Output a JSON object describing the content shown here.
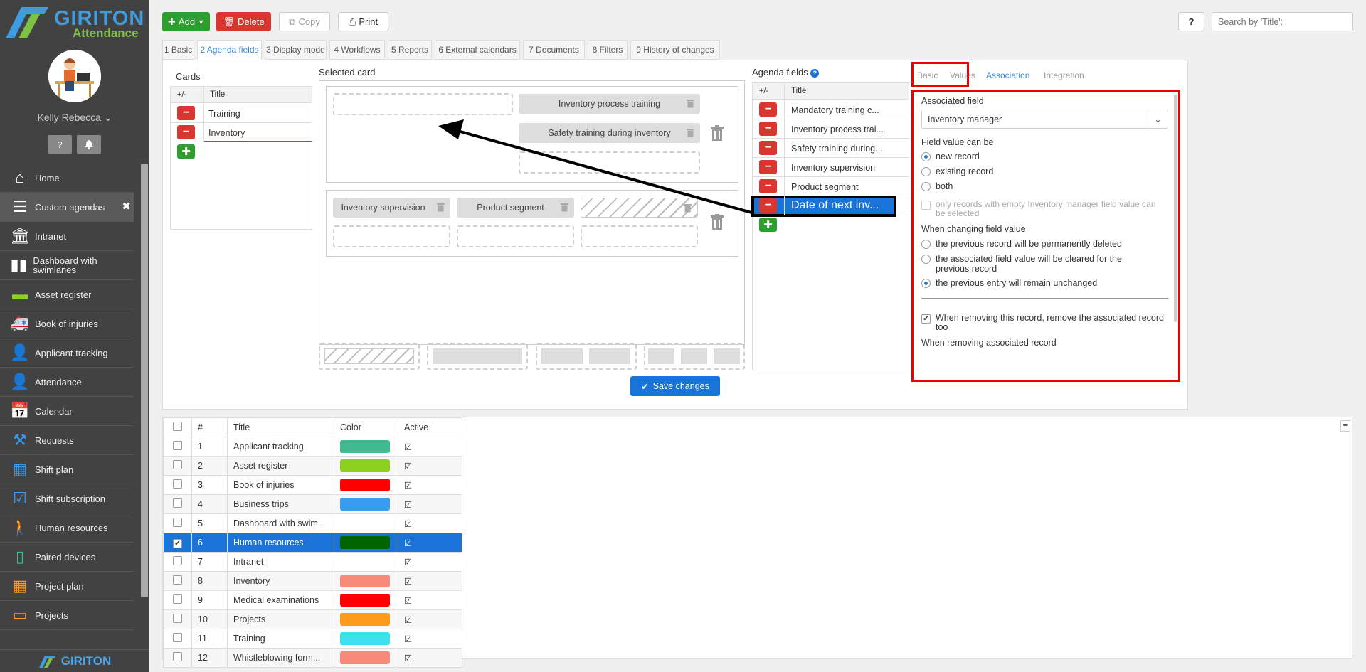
{
  "app": {
    "logo_main": "GIRITON",
    "logo_sub": "Attendance",
    "user": "Kelly Rebecca",
    "footer_logo": "GIRITON"
  },
  "sidebar": {
    "items": [
      {
        "label": "Home",
        "icon": "home-icon",
        "color": "#ffffff"
      },
      {
        "label": "Custom agendas",
        "icon": "list-numbered-icon",
        "color": "#ffffff",
        "active": true
      },
      {
        "label": "Intranet",
        "icon": "building-icon",
        "color": "#ffffff"
      },
      {
        "label": "Dashboard with swimlanes",
        "icon": "columns-icon",
        "color": "#ffffff"
      },
      {
        "label": "Asset register",
        "icon": "archive-box-icon",
        "color": "#8bd11e"
      },
      {
        "label": "Book of injuries",
        "icon": "ambulance-icon",
        "color": "#ff3b2f"
      },
      {
        "label": "Applicant tracking",
        "icon": "user-add-icon",
        "color": "#3dbb8e"
      },
      {
        "label": "Attendance",
        "icon": "user-icon",
        "color": "#3a9cf0"
      },
      {
        "label": "Calendar",
        "icon": "calendar-icon",
        "color": "#3a9cf0"
      },
      {
        "label": "Requests",
        "icon": "gavel-icon",
        "color": "#3a9cf0"
      },
      {
        "label": "Shift plan",
        "icon": "calendar-grid-icon",
        "color": "#3a9cf0"
      },
      {
        "label": "Shift subscription",
        "icon": "calendar-check-icon",
        "color": "#3a9cf0"
      },
      {
        "label": "Human resources",
        "icon": "person-icon",
        "color": "#22c98a"
      },
      {
        "label": "Paired devices",
        "icon": "mobile-icon",
        "color": "#22c98a"
      },
      {
        "label": "Project plan",
        "icon": "calendar-grid-icon",
        "color": "#ff9a1a"
      },
      {
        "label": "Projects",
        "icon": "folder-icon",
        "color": "#ff9a1a"
      }
    ]
  },
  "toolbar": {
    "add": "Add",
    "delete": "Delete",
    "copy": "Copy",
    "print": "Print",
    "help": "?",
    "search_placeholder": "Search by 'Title':"
  },
  "tabs": [
    "1 Basic",
    "2 Agenda fields",
    "3 Display mode",
    "4 Workflows",
    "5 Reports",
    "6 External calendars",
    "7 Documents",
    "8 Filters",
    "9 History of changes"
  ],
  "cards": {
    "heading": "Cards",
    "col_pm": "+/-",
    "col_title": "Title",
    "rows": [
      "Training",
      "Inventory"
    ]
  },
  "selected_card": {
    "heading": "Selected card",
    "chips": [
      "Inventory process training",
      "Safety training during inventory",
      "Inventory supervision",
      "Product segment"
    ]
  },
  "agenda_fields": {
    "heading": "Agenda fields",
    "col_pm": "+/-",
    "col_title": "Title",
    "rows": [
      "Mandatory training c...",
      "Inventory process trai...",
      "Safety training during...",
      "Inventory supervision",
      "Product segment",
      "Date of next inv..."
    ]
  },
  "props": {
    "tabs": [
      "Basic",
      "Values",
      "Association",
      "Integration"
    ],
    "associated_field_label": "Associated field",
    "associated_field_value": "Inventory manager",
    "can_be_label": "Field value can be",
    "can_be_options": [
      "new record",
      "existing record",
      "both"
    ],
    "only_empty": "only records with empty Inventory manager field value can be selected",
    "changing_label": "When changing field value",
    "changing_options": [
      "the previous record will be permanently deleted",
      "the associated field value will be cleared for the previous record",
      "the previous entry will remain unchanged"
    ],
    "remove_assoc": "When removing this record, remove the associated record too",
    "removing_assoc_label": "When removing associated record"
  },
  "save": "Save changes",
  "grid": {
    "cols": [
      "#",
      "Title",
      "Color",
      "Active"
    ],
    "rows": [
      {
        "n": "1",
        "title": "Applicant tracking",
        "color": "#3dbb8e"
      },
      {
        "n": "2",
        "title": "Asset register",
        "color": "#8bd11e"
      },
      {
        "n": "3",
        "title": "Book of injuries",
        "color": "#ff0000"
      },
      {
        "n": "4",
        "title": "Business trips",
        "color": "#3a9cf0"
      },
      {
        "n": "5",
        "title": "Dashboard with swim...",
        "color": ""
      },
      {
        "n": "6",
        "title": "Human resources",
        "color": "#006400",
        "selected": true
      },
      {
        "n": "7",
        "title": "Intranet",
        "color": ""
      },
      {
        "n": "8",
        "title": "Inventory",
        "color": "#f88a7a"
      },
      {
        "n": "9",
        "title": "Medical examinations",
        "color": "#ff0000"
      },
      {
        "n": "10",
        "title": "Projects",
        "color": "#ff9a1a"
      },
      {
        "n": "11",
        "title": "Training",
        "color": "#3de0f0"
      },
      {
        "n": "12",
        "title": "Whistleblowing form...",
        "color": "#f88a7a"
      }
    ]
  }
}
